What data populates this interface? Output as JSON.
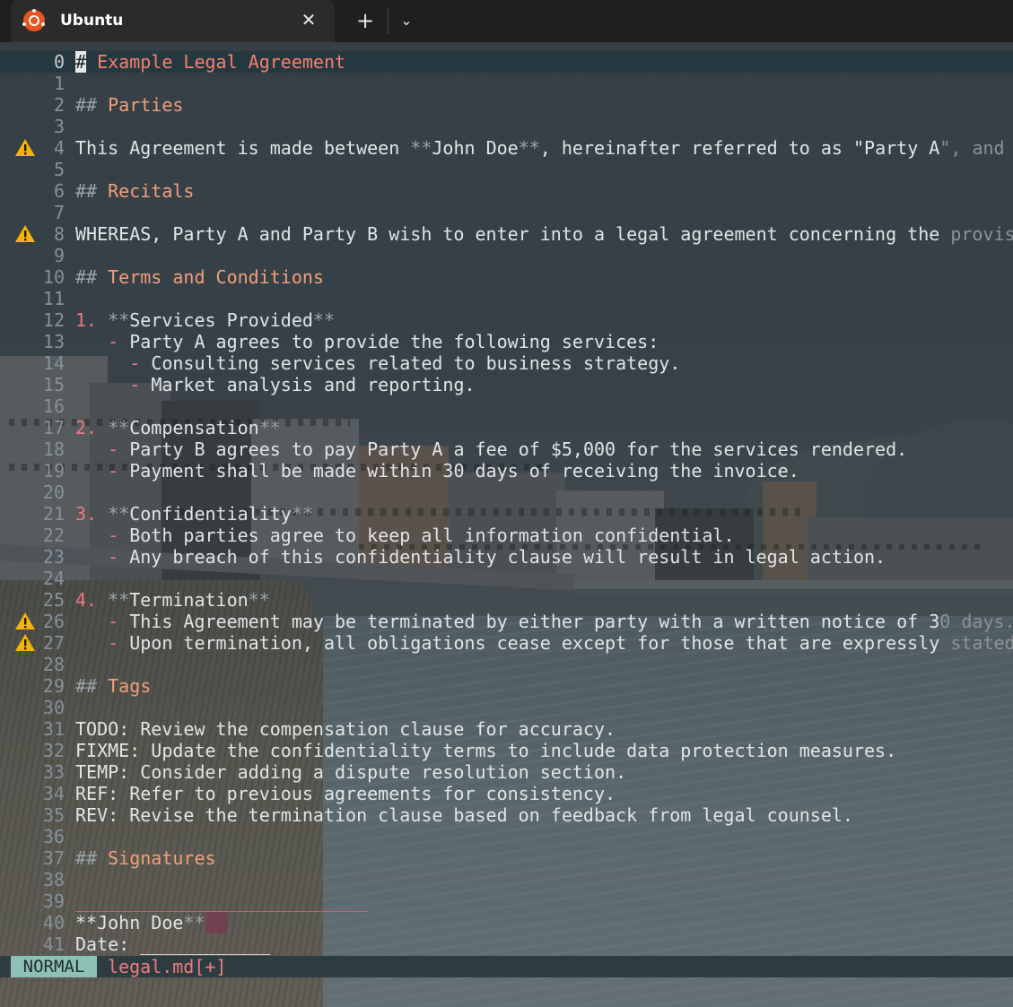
{
  "tab": {
    "title": "Ubuntu",
    "close": "✕",
    "new_tab": "+",
    "dropdown": "⌄"
  },
  "editor": {
    "lines": [
      {
        "n": "0",
        "parts": [
          [
            "cursor",
            "#"
          ],
          [
            "h1",
            " Example Legal Agreement"
          ]
        ],
        "cur": true
      },
      {
        "n": "1",
        "parts": []
      },
      {
        "n": "2",
        "parts": [
          [
            "mk",
            "## "
          ],
          [
            "h",
            "Parties"
          ]
        ]
      },
      {
        "n": "3",
        "parts": []
      },
      {
        "n": "4",
        "warn": true,
        "parts": [
          [
            "",
            "This Agreement is made between "
          ],
          [
            "mk",
            "**"
          ],
          [
            "",
            "John Doe"
          ],
          [
            "mk",
            "**"
          ],
          [
            "",
            ", hereinafter referred to as \"Party A"
          ],
          [
            "dim",
            "\", and"
          ]
        ]
      },
      {
        "n": "5",
        "parts": []
      },
      {
        "n": "6",
        "parts": [
          [
            "mk",
            "## "
          ],
          [
            "h",
            "Recitals"
          ]
        ]
      },
      {
        "n": "7",
        "parts": []
      },
      {
        "n": "8",
        "warn": true,
        "parts": [
          [
            "",
            "WHEREAS, Party A and Party B wish to enter into a legal agreement concerning the "
          ],
          [
            "dim",
            "provis"
          ]
        ]
      },
      {
        "n": "9",
        "parts": []
      },
      {
        "n": "10",
        "parts": [
          [
            "mk",
            "## "
          ],
          [
            "h",
            "Terms and Conditions"
          ]
        ]
      },
      {
        "n": "11",
        "parts": []
      },
      {
        "n": "12",
        "parts": [
          [
            "lst",
            "1. "
          ],
          [
            "mk",
            "**"
          ],
          [
            "",
            "Services Provided"
          ],
          [
            "mk",
            "**"
          ]
        ]
      },
      {
        "n": "13",
        "parts": [
          [
            "",
            "   "
          ],
          [
            "lst",
            "- "
          ],
          [
            "",
            "Party A agrees to provide the following services:"
          ]
        ]
      },
      {
        "n": "14",
        "parts": [
          [
            "",
            "     "
          ],
          [
            "lst",
            "- "
          ],
          [
            "",
            "Consulting services related to business strategy."
          ]
        ]
      },
      {
        "n": "15",
        "parts": [
          [
            "",
            "     "
          ],
          [
            "lst",
            "- "
          ],
          [
            "",
            "Market analysis and reporting."
          ]
        ]
      },
      {
        "n": "16",
        "parts": []
      },
      {
        "n": "17",
        "parts": [
          [
            "lst",
            "2. "
          ],
          [
            "mk",
            "**"
          ],
          [
            "",
            "Compensation"
          ],
          [
            "mk",
            "**"
          ]
        ]
      },
      {
        "n": "18",
        "parts": [
          [
            "",
            "   "
          ],
          [
            "lst",
            "- "
          ],
          [
            "",
            "Party B agrees to pay Party A a fee of $5,000 for the services rendered."
          ]
        ]
      },
      {
        "n": "19",
        "parts": [
          [
            "",
            "   "
          ],
          [
            "lst",
            "- "
          ],
          [
            "",
            "Payment shall be made within 30 days of receiving the invoice."
          ]
        ]
      },
      {
        "n": "20",
        "parts": []
      },
      {
        "n": "21",
        "parts": [
          [
            "lst",
            "3. "
          ],
          [
            "mk",
            "**"
          ],
          [
            "",
            "Confidentiality"
          ],
          [
            "mk",
            "**"
          ]
        ]
      },
      {
        "n": "22",
        "parts": [
          [
            "",
            "   "
          ],
          [
            "lst",
            "- "
          ],
          [
            "",
            "Both parties agree to keep all information confidential."
          ]
        ]
      },
      {
        "n": "23",
        "parts": [
          [
            "",
            "   "
          ],
          [
            "lst",
            "- "
          ],
          [
            "",
            "Any breach of this confidentiality clause will result in legal action."
          ]
        ]
      },
      {
        "n": "24",
        "parts": []
      },
      {
        "n": "25",
        "parts": [
          [
            "lst",
            "4. "
          ],
          [
            "mk",
            "**"
          ],
          [
            "",
            "Termination"
          ],
          [
            "mk",
            "**"
          ]
        ]
      },
      {
        "n": "26",
        "warn": true,
        "parts": [
          [
            "",
            "   "
          ],
          [
            "lst",
            "- "
          ],
          [
            "",
            "This Agreement may be terminated by either party with a written notice of 3"
          ],
          [
            "dim",
            "0 days."
          ]
        ]
      },
      {
        "n": "27",
        "warn": true,
        "parts": [
          [
            "",
            "   "
          ],
          [
            "lst",
            "- "
          ],
          [
            "",
            "Upon termination, all obligations cease except for those that are expressly "
          ],
          [
            "dim",
            "stated"
          ]
        ]
      },
      {
        "n": "28",
        "parts": []
      },
      {
        "n": "29",
        "parts": [
          [
            "mk",
            "## "
          ],
          [
            "h",
            "Tags"
          ]
        ]
      },
      {
        "n": "30",
        "parts": []
      },
      {
        "n": "31",
        "parts": [
          [
            "",
            "TODO: Review the compensation clause for accuracy."
          ]
        ]
      },
      {
        "n": "32",
        "parts": [
          [
            "",
            "FIXME: Update the confidentiality terms to include data protection measures."
          ]
        ]
      },
      {
        "n": "33",
        "parts": [
          [
            "",
            "TEMP: Consider adding a dispute resolution section."
          ]
        ]
      },
      {
        "n": "34",
        "parts": [
          [
            "",
            "REF: Refer to previous agreements for consistency."
          ]
        ]
      },
      {
        "n": "35",
        "parts": [
          [
            "",
            "REV: Revise the termination clause based on feedback from legal counsel."
          ]
        ]
      },
      {
        "n": "36",
        "parts": []
      },
      {
        "n": "37",
        "parts": [
          [
            "mk",
            "## "
          ],
          [
            "h",
            "Signatures"
          ]
        ]
      },
      {
        "n": "38",
        "parts": []
      },
      {
        "n": "39",
        "parts": [
          [
            "pink",
            "___________________________"
          ]
        ]
      },
      {
        "n": "40",
        "parts": [
          [
            "",
            "**John Doe"
          ],
          [
            "mk",
            "**"
          ],
          [
            "block",
            ""
          ]
        ]
      },
      {
        "n": "41",
        "parts": [
          [
            "",
            "Date: ____________"
          ]
        ]
      }
    ]
  },
  "statusbar": {
    "mode": "NORMAL",
    "filename": "legal.md[+]"
  },
  "icons": {
    "warning": "warning-icon",
    "logo": "ubuntu-logo-icon"
  },
  "colors": {
    "heading": "#f2a07a",
    "list_marker": "#f2787e",
    "mode_bg": "#8ec1b5",
    "warning": "#f5b400"
  }
}
